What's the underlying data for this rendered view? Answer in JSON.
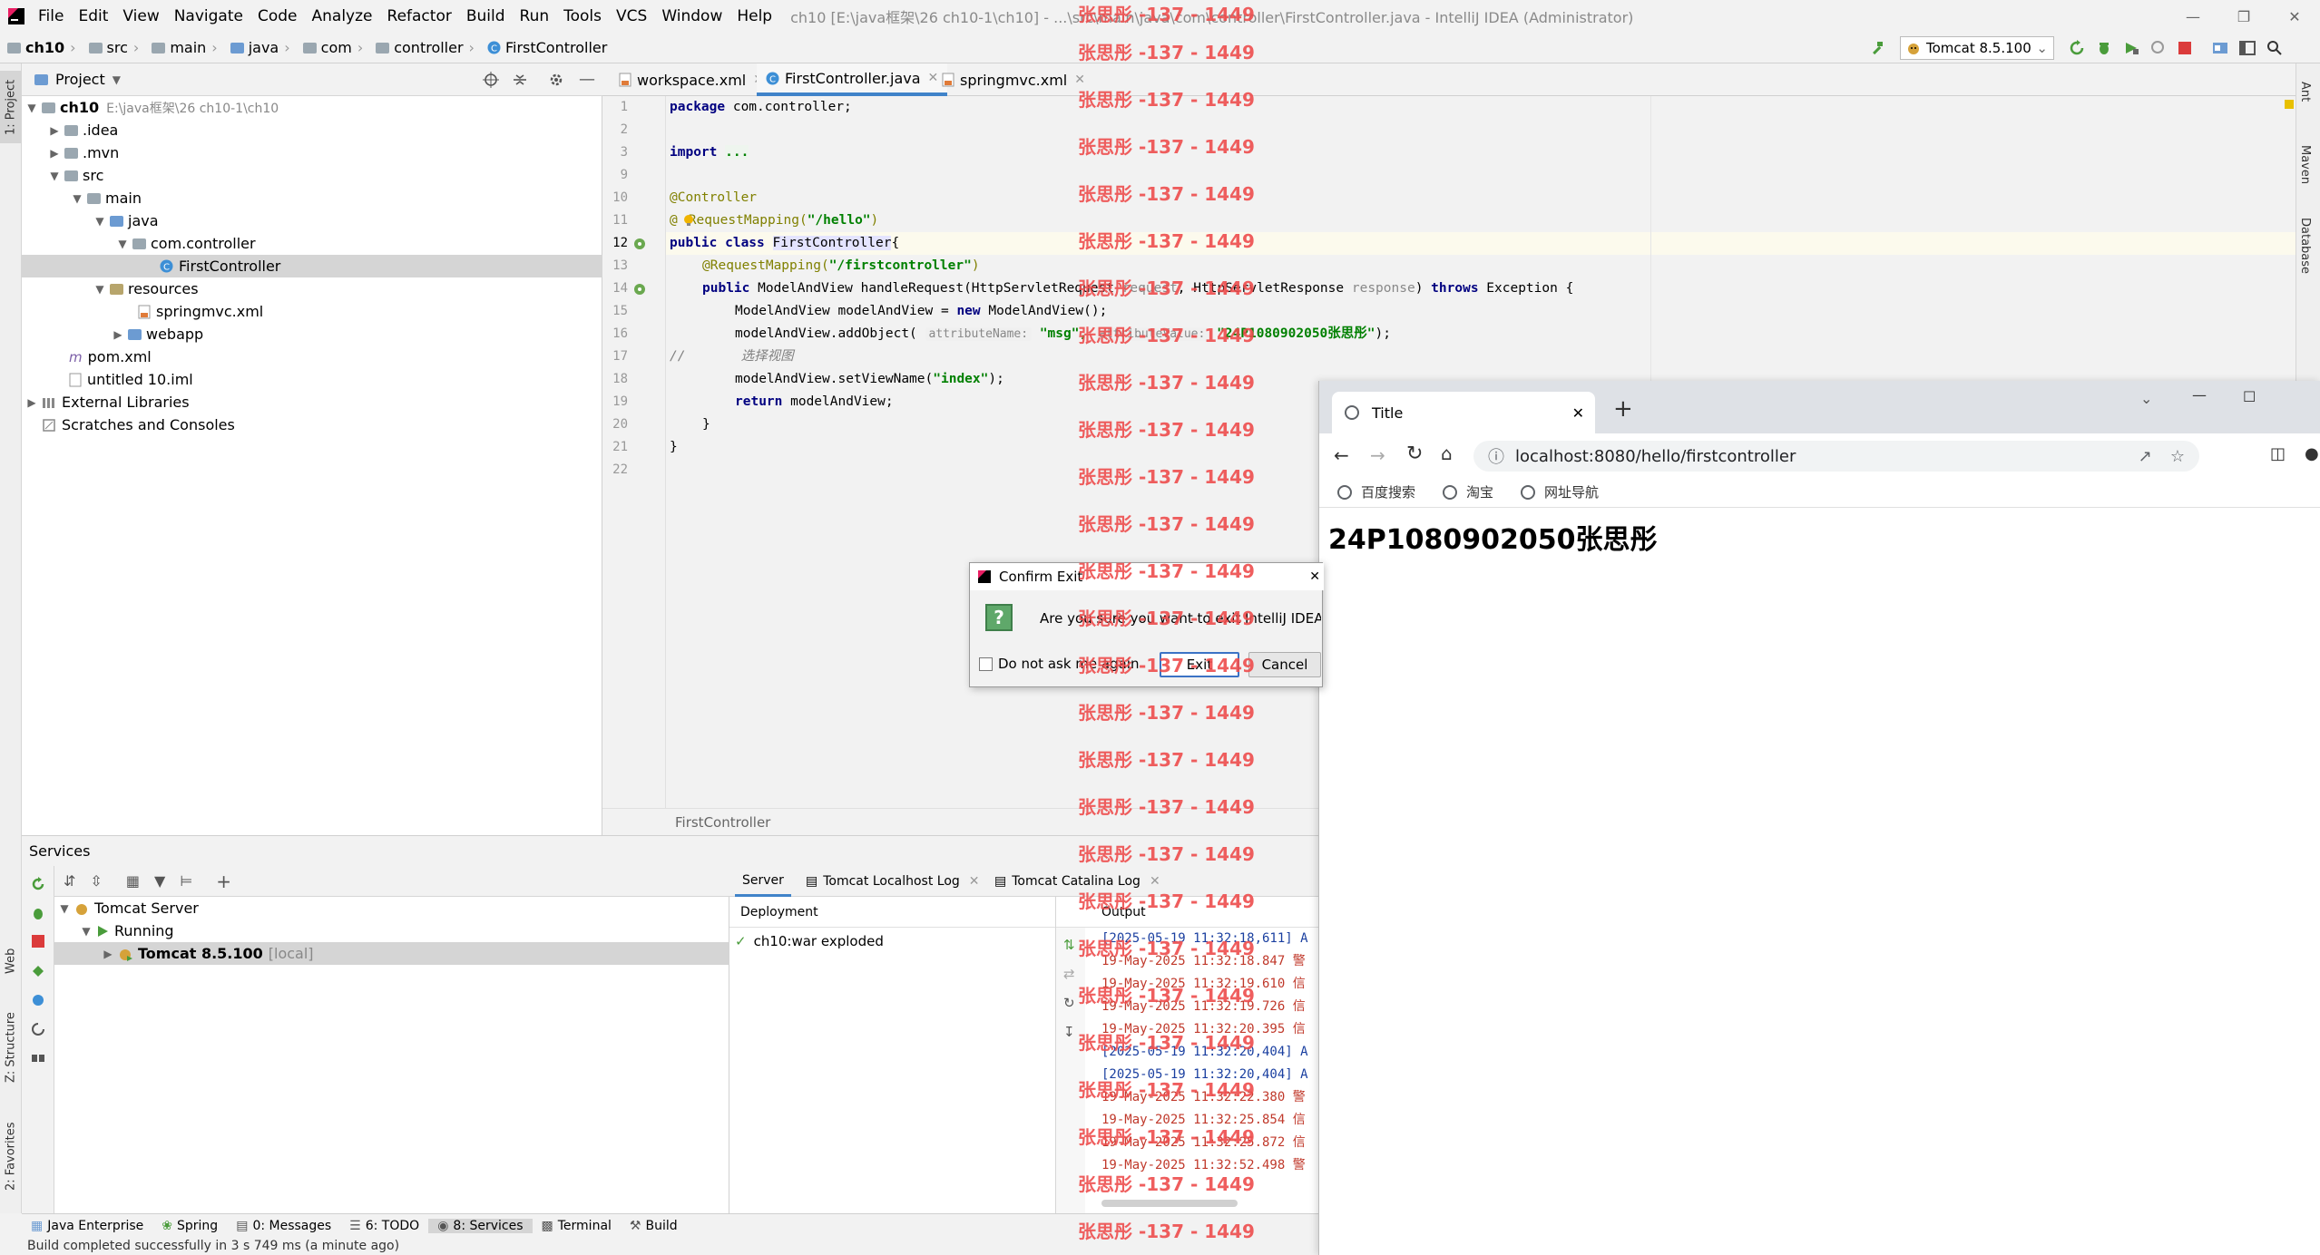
{
  "menubar": {
    "items": [
      "File",
      "Edit",
      "View",
      "Navigate",
      "Code",
      "Analyze",
      "Refactor",
      "Build",
      "Run",
      "Tools",
      "VCS",
      "Window",
      "Help"
    ],
    "title": "ch10 [E:\\java框架\\26 ch10-1\\ch10] - ...\\src\\main\\java\\com\\controller\\FirstController.java - IntelliJ IDEA (Administrator)"
  },
  "navbar": {
    "crumbs": [
      "ch10",
      "src",
      "main",
      "java",
      "com",
      "controller",
      "FirstController"
    ],
    "run_config": "Tomcat 8.5.100"
  },
  "project_panel": {
    "title": "Project",
    "tree": [
      {
        "label": "ch10",
        "extra": "E:\\java框架\\26 ch10-1\\ch10"
      },
      {
        "label": ".idea"
      },
      {
        "label": ".mvn"
      },
      {
        "label": "src"
      },
      {
        "label": "main"
      },
      {
        "label": "java"
      },
      {
        "label": "com.controller"
      },
      {
        "label": "FirstController"
      },
      {
        "label": "resources"
      },
      {
        "label": "springmvc.xml"
      },
      {
        "label": "webapp"
      },
      {
        "label": "pom.xml"
      },
      {
        "label": "untitled 10.iml"
      },
      {
        "label": "External Libraries"
      },
      {
        "label": "Scratches and Consoles"
      }
    ]
  },
  "editor": {
    "tabs": [
      "workspace.xml",
      "FirstController.java",
      "springmvc.xml"
    ],
    "line_numbers": [
      "1",
      "2",
      "3",
      "9",
      "10",
      "11",
      "12",
      "13",
      "14",
      "15",
      "16",
      "17",
      "18",
      "19",
      "20",
      "21",
      "22"
    ],
    "code": {
      "l1a": "package ",
      "l1b": "com.controller;",
      "l3a": "import ",
      "l3b": "...",
      "l10": "@Controller",
      "l11a": "@",
      "l11b": "RequestMapping(",
      "l11c": "\"/hello\"",
      "l11d": ")",
      "l12a": "public class ",
      "l12b": "FirstController",
      "l12c": "{",
      "l13a": "@RequestMapping(",
      "l13b": "\"/firstcontroller\"",
      "l13c": ")",
      "l14a": "public ",
      "l14b": "ModelAndView handleRequest(HttpServletRequest ",
      "l14c": "request",
      ", ": "",
      "l14d": ", HttpServletResponse ",
      "l14e": "response",
      ")": "",
      "l14f": ") ",
      "l14g": "throws ",
      "l14h": "Exception {",
      "l15a": "ModelAndView modelAndView = ",
      "l15b": "new ",
      "l15c": "ModelAndView();",
      "l16a": "modelAndView.addObject( ",
      "l16h1": "attributeName:",
      "l16b": " \"msg\", ",
      "l16h2": "attributeValue:",
      "l16c": " \"24P1080902050张思彤\"",
      "l16d": ");",
      "l17a": "//       ",
      "l17b": "选择视图",
      "l18a": "modelAndView.setViewName(",
      "l18b": "\"index\"",
      "l18c": ");",
      "l19a": "return ",
      "l19b": "modelAndView;",
      "l20": "}",
      "l21": "}"
    },
    "footer": "FirstController"
  },
  "services": {
    "title": "Services",
    "tree": [
      {
        "label": "Tomcat Server"
      },
      {
        "label": "Running"
      },
      {
        "label": "Tomcat 8.5.100",
        "extra": "[local]"
      }
    ],
    "tabs": [
      "Server",
      "Tomcat Localhost Log",
      "Tomcat Catalina Log"
    ],
    "deployment_header": "Deployment",
    "deployment_item": "ch10:war exploded",
    "output_header": "Output",
    "output_lines": [
      "[2025-05-19 11:32:18,611] A",
      "19-May-2025 11:32:18.847 警",
      "19-May-2025 11:32:19.610 信",
      "19-May-2025 11:32:19.726 信",
      "19-May-2025 11:32:20.395 信",
      "[2025-05-19 11:32:20,404] A",
      "[2025-05-19 11:32:20,404] A",
      "19-May-2025 11:32:22.380 警",
      "19-May-2025 11:32:25.854 信",
      "19-May-2025 11:32:25.872 信",
      "19-May-2025 11:32:52.498 警"
    ]
  },
  "bottom_tabs": [
    "Java Enterprise",
    "Spring",
    "0: Messages",
    "6: TODO",
    "8: Services",
    "Terminal",
    "Build"
  ],
  "status": "Build completed successfully in 3 s 749 ms (a minute ago)",
  "left_stripe": [
    "1: Project",
    "Web",
    "Z: Structure",
    "2: Favorites"
  ],
  "right_stripe": [
    "Ant",
    "Maven",
    "Database"
  ],
  "dialog": {
    "title": "Confirm Exit",
    "message": "Are you sure you want to exit IntelliJ IDEA?",
    "checkbox": "Do not ask me again",
    "exit": "Exit",
    "cancel": "Cancel"
  },
  "browser": {
    "tab_title": "Title",
    "url": "localhost:8080/hello/firstcontroller",
    "bookmarks": [
      "百度搜索",
      "淘宝",
      "网址导航"
    ],
    "content": "24P1080902050张思彤"
  },
  "watermark": "张思彤 -137 - 1449",
  "colors": {
    "accent": "#4083c9",
    "keyword": "#000080",
    "string": "#008000",
    "annotation": "#808000",
    "watermark": "#ee4d4d"
  }
}
